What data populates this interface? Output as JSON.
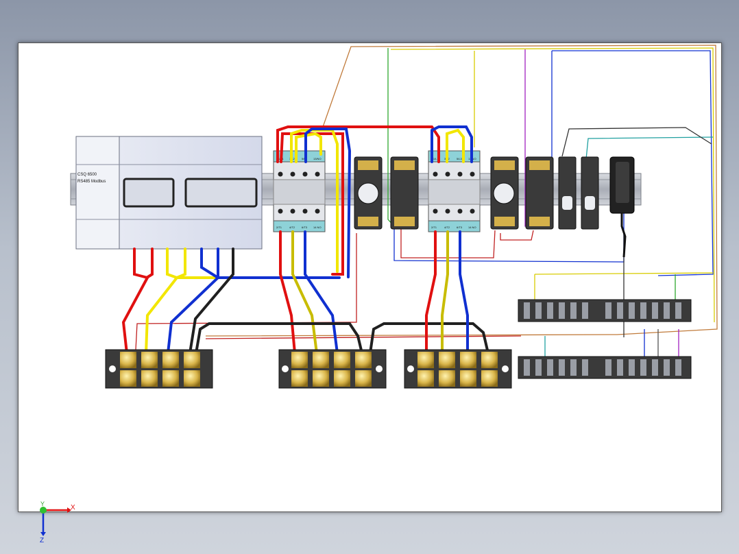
{
  "meter": {
    "line1": "CSQ 6500",
    "line2": "RS485 Modbus"
  },
  "contactor": {
    "top_labels": [
      "R1/L1",
      "3/L2",
      "5/L3",
      "13/NO"
    ],
    "bottom_labels": [
      "2/T1",
      "4/T2",
      "6/T3",
      "14 NO"
    ]
  },
  "axes": {
    "x": "X",
    "y": "Y",
    "z": "Z"
  },
  "colors": {
    "wire_red": "#e01010",
    "wire_yellow": "#f2e600",
    "wire_blue": "#1030d0",
    "wire_black": "#202020",
    "dinrail": "#b8bcc4",
    "background": "#ffffff"
  }
}
